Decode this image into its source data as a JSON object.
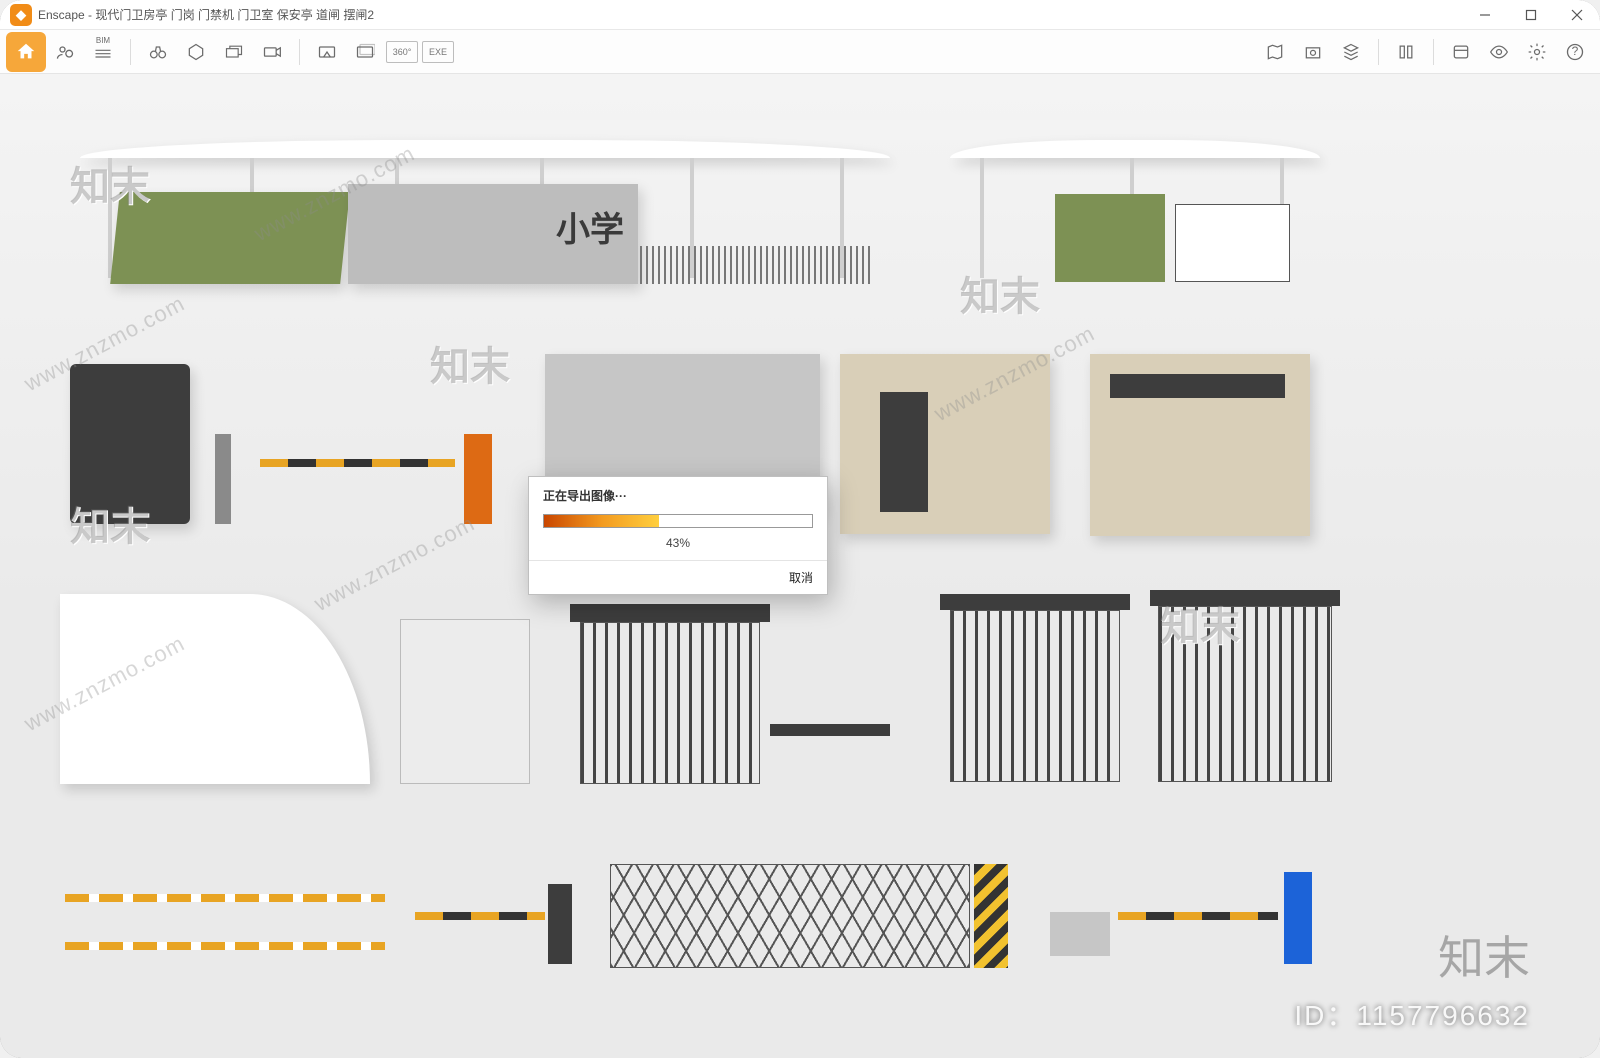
{
  "window": {
    "app_name": "Enscape",
    "title": "Enscape - 现代门卫房亭 门岗 门禁机 门卫室 保安亭 道闸 摆闸2"
  },
  "titlebar_buttons": {
    "minimize": "minimize",
    "maximize": "maximize",
    "close": "close"
  },
  "toolbar_left": {
    "home": "home",
    "login": "login",
    "bim_label": "BIM",
    "binoculars": "binoculars",
    "walk_mode": "walk_mode",
    "perspective": "perspective",
    "video": "video"
  },
  "toolbar_mid": {
    "screenshot": "screenshot",
    "batch_render": "batch_render",
    "mono_360_label": "360°",
    "exe_label": "EXE"
  },
  "toolbar_right": {
    "mini_map": "mini_map",
    "asset_lib": "asset_lib",
    "materials": "materials",
    "views": "views",
    "sun": "sun",
    "show_hide": "show_hide",
    "visual_settings": "visual_settings",
    "help": "?"
  },
  "dialog": {
    "title": "正在导出图像···",
    "percent": "43%",
    "percent_value": 43,
    "cancel": "取消"
  },
  "scene_labels": {
    "school_sign": "小学"
  },
  "watermarks": {
    "url": "www.znzmo.com",
    "brand": "知末",
    "id": "ID：1157796632"
  }
}
